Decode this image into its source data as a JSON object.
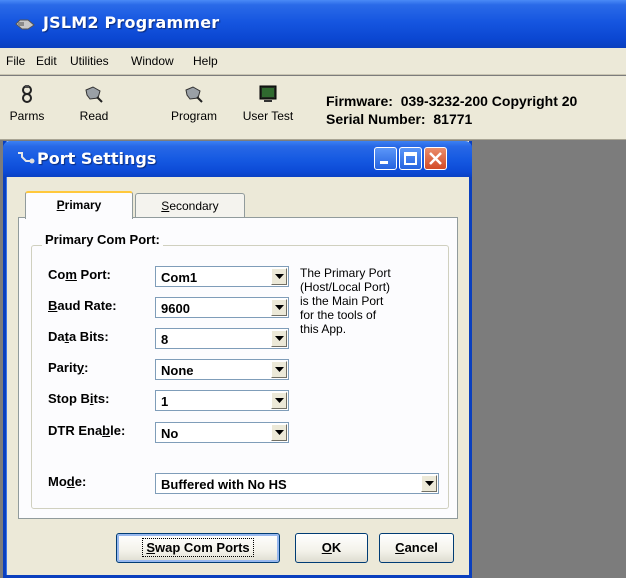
{
  "app": {
    "title": "JSLM2 Programmer"
  },
  "menu": {
    "file": "File",
    "edit": "Edit",
    "utilities": "Utilities",
    "window": "Window",
    "help": "Help"
  },
  "toolbar": {
    "parms": "Parms",
    "read": "Read",
    "program": "Program",
    "user_test": "User Test"
  },
  "info": {
    "firmware_label": "Firmware:",
    "firmware_value": "039-3232-200 Copyright 20",
    "serial_label": "Serial Number:",
    "serial_value": "81771"
  },
  "dialog": {
    "title": "Port Settings",
    "tabs": {
      "primary": {
        "pre": "",
        "ul": "P",
        "post": "rimary"
      },
      "secondary": {
        "pre": "",
        "ul": "S",
        "post": "econdary"
      }
    },
    "group_title": "Primary Com Port:",
    "fields": {
      "com_port": {
        "pre": "Co",
        "ul": "m",
        "post": " Port:",
        "value": "Com1"
      },
      "baud_rate": {
        "pre": "",
        "ul": "B",
        "post": "aud Rate:",
        "value": "9600"
      },
      "data_bits": {
        "pre": "Da",
        "ul": "t",
        "post": "a Bits:",
        "value": "8"
      },
      "parity": {
        "pre": "Parit",
        "ul": "y",
        "post": ":",
        "value": "None"
      },
      "stop_bits": {
        "pre": "Stop B",
        "ul": "i",
        "post": "ts:",
        "value": "1"
      },
      "dtr_enable": {
        "pre": "DTR Ena",
        "ul": "b",
        "post": "le:",
        "value": "No"
      },
      "mode": {
        "pre": "Mo",
        "ul": "d",
        "post": "e:",
        "value": "Buffered with No HS"
      }
    },
    "help_lines": [
      "The Primary Port",
      "(Host/Local Port)",
      "is the Main Port",
      "for the tools of",
      "this App."
    ],
    "buttons": {
      "swap": {
        "pre": "",
        "ul": "S",
        "post": "wap Com Ports"
      },
      "ok": {
        "pre": "",
        "ul": "O",
        "post": "K"
      },
      "cancel": {
        "pre": "",
        "ul": "C",
        "post": "ancel"
      }
    }
  },
  "colors": {
    "titlebar": "#0b47d2",
    "window_bg": "#ece9d8",
    "desktop": "#7c7c7c"
  }
}
